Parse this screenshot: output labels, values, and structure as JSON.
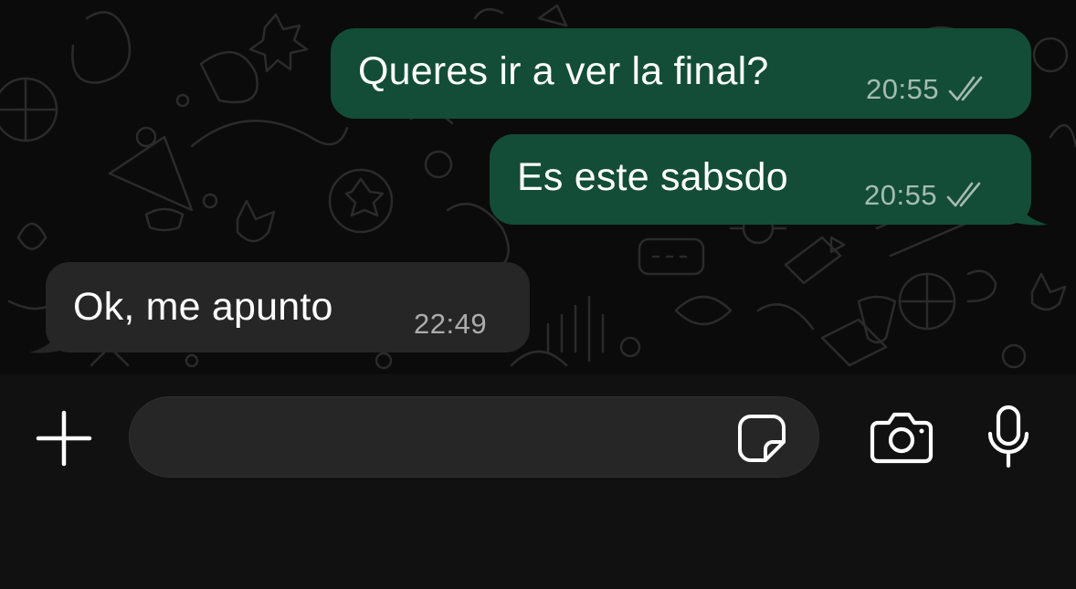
{
  "messages": [
    {
      "direction": "outgoing",
      "text": "Queres ir a ver la final?",
      "time": "20:55",
      "status_icon": "double-check-icon"
    },
    {
      "direction": "outgoing",
      "text": "Es este sabsdo",
      "time": "20:55",
      "status_icon": "double-check-icon"
    },
    {
      "direction": "incoming",
      "text": "Ok, me apunto",
      "time": "22:49"
    }
  ],
  "composer": {
    "input_value": "",
    "input_placeholder": "",
    "icons": [
      "plus-icon",
      "sticker-icon",
      "camera-icon",
      "microphone-icon"
    ]
  },
  "colors": {
    "outgoing_bubble": "#134d37",
    "incoming_bubble": "#262626",
    "chat_background": "#0b0b0b",
    "composer_background": "#111111",
    "input_background": "#262626"
  }
}
